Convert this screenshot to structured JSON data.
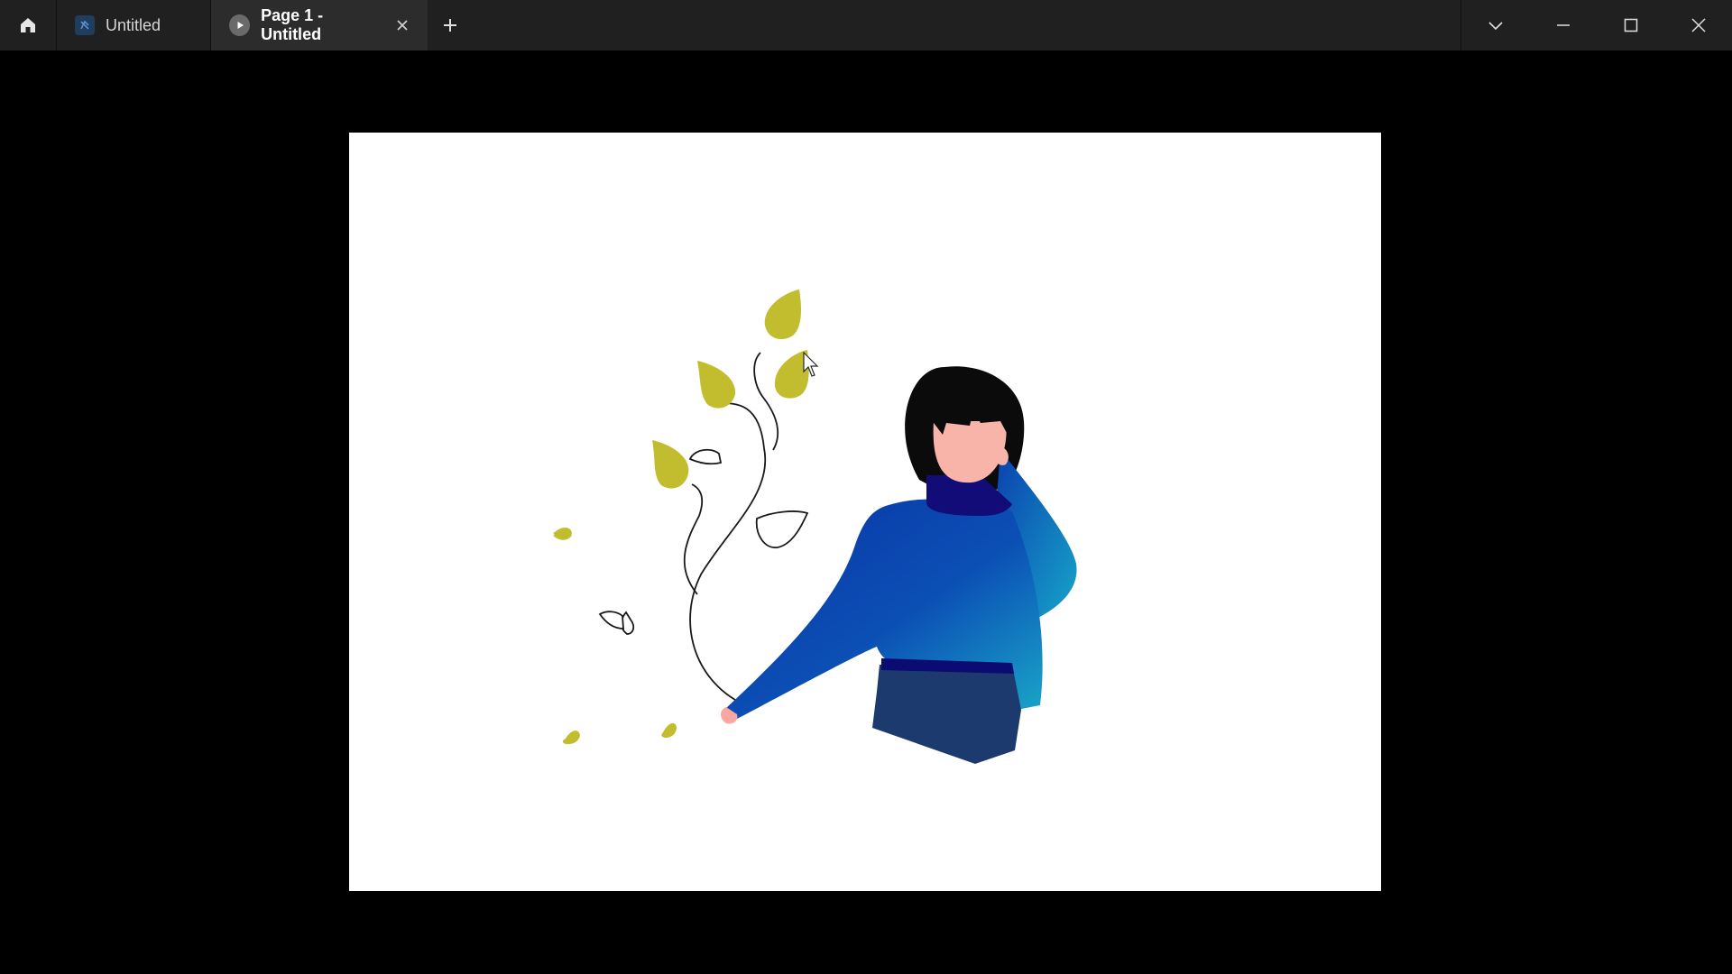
{
  "titlebar": {
    "tabs": [
      {
        "label": "Untitled",
        "icon": "figma-file-icon",
        "active": false
      },
      {
        "label": "Page 1 - Untitled",
        "icon": "play-icon",
        "active": true
      }
    ],
    "home_icon": "home-icon",
    "new_tab_icon": "plus-icon",
    "close_tab_icon": "close-icon",
    "window_controls": [
      "chevron-down-icon",
      "minimize-icon",
      "maximize-icon",
      "close-icon"
    ]
  },
  "colors": {
    "titlebar_bg": "#202020",
    "active_tab_bg": "#2c2c2c",
    "canvas_bg": "#000000",
    "frame_bg": "#ffffff",
    "leaf": "#c2bd2e",
    "sweater_dark": "#0b3aa8",
    "sweater_light": "#1aa3c6",
    "turtleneck": "#100c78",
    "pants": "#1c3a6e",
    "skin": "#f8b4a8",
    "hair": "#0b0b0b"
  },
  "illustration": {
    "subject": "woman-with-vine-illustration"
  }
}
